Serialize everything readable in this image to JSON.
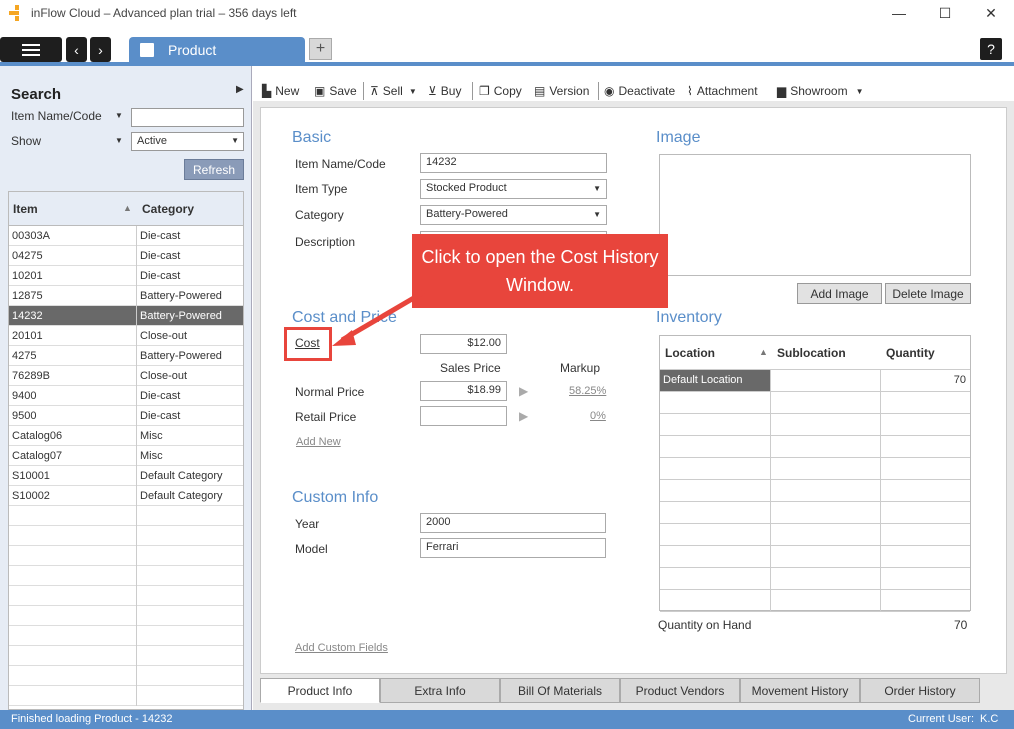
{
  "window": {
    "title": "inFlow Cloud – Advanced plan trial – 356 days left",
    "minimize": "—",
    "maximize": "☐",
    "close": "✕"
  },
  "tabs": {
    "active_label": "Product",
    "add": "+",
    "help": "?"
  },
  "sidebar": {
    "title": "Search",
    "filter_field_label": "Item Name/Code",
    "show_label": "Show",
    "show_value": "Active",
    "refresh": "Refresh",
    "grid": {
      "col_item": "Item",
      "col_category": "Category",
      "rows": [
        {
          "item": "00303A",
          "category": "Die-cast"
        },
        {
          "item": "04275",
          "category": "Die-cast"
        },
        {
          "item": "10201",
          "category": "Die-cast"
        },
        {
          "item": "12875",
          "category": "Battery-Powered"
        },
        {
          "item": "14232",
          "category": "Battery-Powered"
        },
        {
          "item": "20101",
          "category": "Close-out"
        },
        {
          "item": "4275",
          "category": "Battery-Powered"
        },
        {
          "item": "76289B",
          "category": "Close-out"
        },
        {
          "item": "9400",
          "category": "Die-cast"
        },
        {
          "item": "9500",
          "category": "Die-cast"
        },
        {
          "item": "Catalog06",
          "category": "Misc"
        },
        {
          "item": "Catalog07",
          "category": "Misc"
        },
        {
          "item": "S10001",
          "category": "Default Category"
        },
        {
          "item": "S10002",
          "category": "Default Category"
        }
      ],
      "selected_item": "14232"
    }
  },
  "toolbar": {
    "new": "New",
    "save": "Save",
    "sell": "Sell",
    "buy": "Buy",
    "copy": "Copy",
    "version": "Version",
    "deactivate": "Deactivate",
    "attachment": "Attachment",
    "showroom": "Showroom"
  },
  "basic": {
    "title": "Basic",
    "item_code_label": "Item Name/Code",
    "item_code_value": "14232",
    "item_type_label": "Item Type",
    "item_type_value": "Stocked Product",
    "category_label": "Category",
    "category_value": "Battery-Powered",
    "description_label": "Description"
  },
  "cost_price": {
    "title": "Cost and Price",
    "cost_label": "Cost",
    "cost_value": "$12.00",
    "sales_price_header": "Sales Price",
    "markup_header": "Markup",
    "normal_label": "Normal Price",
    "normal_value": "$18.99",
    "normal_markup": "58.25%",
    "retail_label": "Retail Price",
    "retail_value": "",
    "retail_markup": "0%",
    "add_new": "Add New"
  },
  "custom": {
    "title": "Custom Info",
    "year_label": "Year",
    "year_value": "2000",
    "model_label": "Model",
    "model_value": "Ferrari",
    "add_fields": "Add Custom Fields"
  },
  "image": {
    "title": "Image",
    "add": "Add Image",
    "delete": "Delete Image"
  },
  "inventory": {
    "title": "Inventory",
    "col_location": "Location",
    "col_sublocation": "Sublocation",
    "col_quantity": "Quantity",
    "rows": [
      {
        "location": "Default Location",
        "sublocation": "",
        "quantity": "70"
      }
    ],
    "on_hand_label": "Quantity on Hand",
    "on_hand_value": "70"
  },
  "bottom_tabs": [
    "Product Info",
    "Extra Info",
    "Bill Of Materials",
    "Product Vendors",
    "Movement History",
    "Order History"
  ],
  "status": {
    "message": "Finished loading Product - 14232",
    "user_label": "Current User:",
    "user_value": "K.C"
  },
  "annotation": {
    "text": "Click to open the Cost History Window."
  },
  "colors": {
    "accent": "#5a8ec9",
    "callout": "#e8453c",
    "selected_row": "#696969"
  }
}
